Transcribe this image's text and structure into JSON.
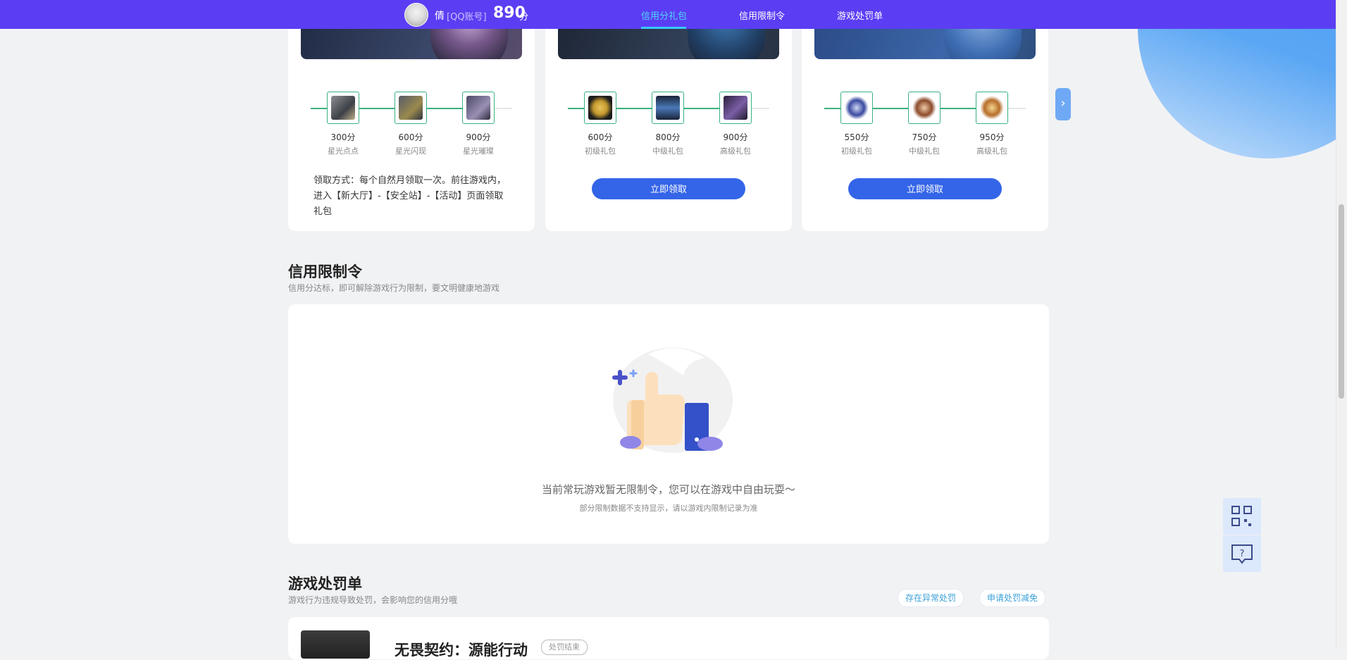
{
  "topbar": {
    "user_name": "倩",
    "account_type": "[QQ账号]",
    "score": "890",
    "score_unit": "分",
    "nav": [
      {
        "label": "信用分礼包",
        "active": true
      },
      {
        "label": "信用限制令",
        "active": false
      },
      {
        "label": "游戏处罚单",
        "active": false
      }
    ]
  },
  "gift_cards": [
    {
      "items": [
        {
          "value": "300分",
          "label": "星光点点",
          "icon": "star-gem-icon"
        },
        {
          "value": "600分",
          "label": "星光闪现",
          "icon": "star-gem-icon"
        },
        {
          "value": "900分",
          "label": "星光璀璨",
          "icon": "star-gem-icon"
        }
      ],
      "claim_text": "领取方式：每个自然月领取一次。前往游戏内，进入【新大厅】-【安全站】-【活动】页面领取礼包"
    },
    {
      "items": [
        {
          "value": "600分",
          "label": "初级礼包",
          "icon": "coin-icon"
        },
        {
          "value": "800分",
          "label": "中级礼包",
          "icon": "gun-case-icon"
        },
        {
          "value": "900分",
          "label": "高级礼包",
          "icon": "treasure-chest-icon"
        }
      ],
      "button": "立即领取"
    },
    {
      "items": [
        {
          "value": "550分",
          "label": "初级礼包",
          "icon": "rank-badge-icon"
        },
        {
          "value": "750分",
          "label": "中级礼包",
          "icon": "rank-badge-icon"
        },
        {
          "value": "950分",
          "label": "高级礼包",
          "icon": "rank-badge-icon"
        }
      ],
      "button": "立即领取"
    }
  ],
  "restriction": {
    "title": "信用限制令",
    "subtitle": "信用分达标，即可解除游戏行为限制，要文明健康地游戏",
    "empty_main": "当前常玩游戏暂无限制令，您可以在游戏中自由玩耍～",
    "empty_sub": "部分限制数据不支持显示，请以游戏内限制记录为准"
  },
  "penalty": {
    "title": "游戏处罚单",
    "subtitle": "游戏行为违规导致处罚，会影响您的信用分哦",
    "pill_abnormal": "存在异常处罚",
    "pill_reduce": "申请处罚减免",
    "first_game_title": "无畏契约：源能行动",
    "first_game_badge": "处罚结束"
  },
  "colors": {
    "topbar": "#5b3ef3",
    "active_nav": "#4ed8ff",
    "button": "#3465e8",
    "track": "#39b180"
  }
}
